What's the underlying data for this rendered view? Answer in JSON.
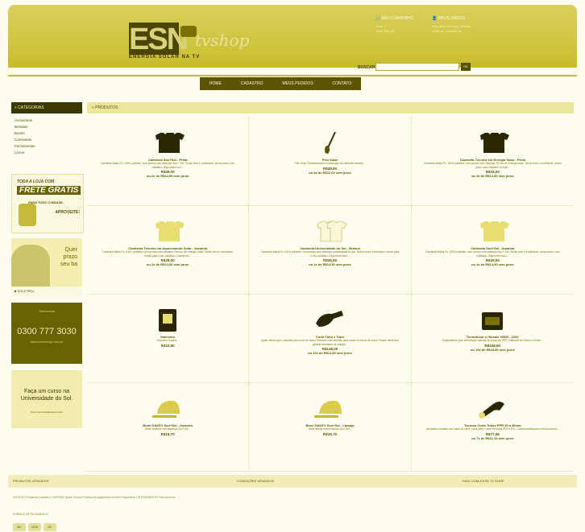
{
  "header": {
    "logo_text": "ESN",
    "logo_shop": "tvshop",
    "tagline": "ENERGIA SOLAR NA TV",
    "cart_label": "MEU CARRINHO",
    "cart_items": "Itens: 0",
    "cart_total": "Total: R$0,00",
    "account_label": "MEUS DADOS",
    "account_line1": "Seja bem-vindo(a) visitante",
    "account_line2": "Login ou cadastre-se",
    "search_label": "BUSCAR",
    "search_button": "OK"
  },
  "nav": [
    "HOME",
    "CADASTRO",
    "MEUS PEDIDOS",
    "CONTATO"
  ],
  "sidebar": {
    "heading": "» CATEGORIAS",
    "categories": [
      "Acessórios",
      "Bebidas",
      "Bonés",
      "Camisetas",
      "Ferramentas",
      "Livros"
    ]
  },
  "banners": {
    "frete_line1": "TODA A LOJA COM",
    "frete_line2": "FRETE GRÁTIS",
    "frete_line3": "PARA TODO O BRASIL",
    "frete_cta": "APROVEITE!",
    "quer_text": "Quer\nprazo\nseu ba",
    "phone_small": "Televendas",
    "phone": "0300 777 3030",
    "phone_site": "www.esntvshop.com.br",
    "curso_text": "Faça um curso na\nUniversidade do Sol.",
    "curso_site": "www.universidadedosol.org.br"
  },
  "products_heading": "» PRODUTOS",
  "products": [
    {
      "name": "Camiseta Sou+Sol - Preta",
      "desc": "Camiseta Malha Pv, 100% poliéster, com pontos com estampa Sou + Sol. Tecido leve e confortável, sendo para o uso cotidiano. Disponível nos t...",
      "price": "R$29,00",
      "inst": "ou 2x de R$14,50 sem juros",
      "icon": "shirt-black"
    },
    {
      "name": "Flex Solar",
      "desc": "Flex Solar Sabedoria para a instalação de coletores solares...",
      "price": "R$48,00",
      "inst": "ou 4x de R$12,00 sem juros",
      "icon": "tool"
    },
    {
      "name": "Camiseta Técnica em Energia Solar - Preta",
      "desc": "Camiseta Malha Pv, 100% poliéster, com pontos com estampa TE era um Energia solar. Tecido leve e confortável, sendo para o uso cotidiano no trab...",
      "price": "R$29,00",
      "inst": "ou 2x de R$14,50 sem juros",
      "icon": "shirt-black"
    },
    {
      "name": "Camiseta Técnico em Aquecimento Solar - Amarela",
      "desc": "Camiseta Malha Pv, 100% poliéster, com pontos com estampa Técnico em energia Solar. Tecido leve e confortável, sendo para o uso cotidiano. Disponível...",
      "price": "R$29,00",
      "inst": "ou 2x de R$14,50 sem juros",
      "icon": "shirt-yellow"
    },
    {
      "name": "Camiseta Universidade do Sol - Branca",
      "desc": "Camiseta Malha Pv, 100% poliéster, com pontos com estampa Universidade do sol. Tecido leve e confortável, sendo para o uso cotidiano. Disponível nos t...",
      "price": "R$29,00",
      "inst": "ou 2x de R$14,50 sem juros",
      "icon": "shirt-white"
    },
    {
      "name": "Camiseta Sou+Sol - Amarela",
      "desc": "Camiseta Malha Pv, 100% poliéster, com pontos com estampa Sou + Sol. Tecido leve e confortável, sendo para o uso cotidiano. Disponível nos t...",
      "price": "R$29,00",
      "inst": "ou 2x de R$14,50 sem juros",
      "icon": "shirt-yellow"
    },
    {
      "name": "Solímetro",
      "desc": "Solímetro Solarís...",
      "price": "R$15,90",
      "inst": "",
      "icon": "meter"
    },
    {
      "name": "Corta Tubo e Tubo",
      "desc": "Ajuste telescópico, utilizado para corte de tubos. Robusto, com lâminas para cortar em tubos de cobre. Possui rolete que garante facilidade no manejo...",
      "price": "R$148,00",
      "inst": "ou 10x de R$14,80 sem juros",
      "icon": "cutter"
    },
    {
      "name": "Termofusor c/ Bocais 900W - 220V",
      "desc": "Equipamento para termofusão manual de peças em PPR. Diâmetro de 20mm a 63mm...",
      "price": "R$448,90",
      "inst": "ou 10x de R$44,89 sem juros",
      "icon": "case"
    },
    {
      "name": "Boné DAKEY Sou+Sol - Amarelo",
      "desc": "Boné Amarelo com estampa Sou+Sol...",
      "price": "R$15,70",
      "inst": "",
      "icon": "cap"
    },
    {
      "name": "Boné DAKEY Sou+Sol - Laranja",
      "desc": "Boné laranja com estampa Sou+Sol...",
      "price": "R$15,70",
      "inst": "",
      "icon": "cap"
    },
    {
      "name": "Tesoura Corta Tubos PPR 20 a 40mm",
      "desc": "Acionada a catraca com cabo de nylon, ideal para o corte de tubos PPR e PVC. Desenvolvida para cortes precisos...",
      "price": "R$77,99",
      "inst": "ou 7x de R$11,14 sem juros",
      "icon": "scissors"
    }
  ],
  "footer": {
    "col1": "PRODUTOS VENDIDOS",
    "col2": "CONDIÇÕES VENDIDOS",
    "col3": "FALE COM A ESN TV SHOP",
    "links": "CONTATO  Estamos  Cadastro  |  NOSSAS  Quem Somos  Política de pagamento e envio  Segurança  |  ATENDIMENTO  Fale conosco",
    "payment_label": "FORMAS DE PAGAMENTO",
    "cards": [
      "MC",
      "VISA",
      "DC"
    ]
  }
}
